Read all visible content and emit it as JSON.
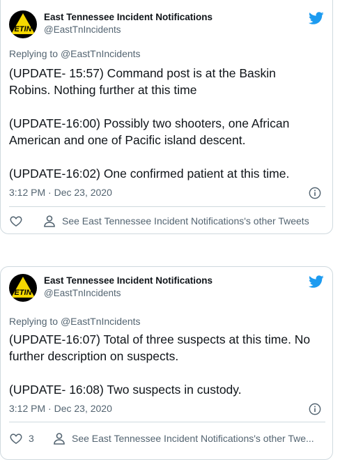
{
  "account": {
    "name": "East Tennessee Incident Notifications",
    "handle": "@EastTnIncidents",
    "avatar_text": "ETIN"
  },
  "colors": {
    "brand_yellow": "#f5d800",
    "twitter_blue": "#1d9bf0",
    "gray": "#536471"
  },
  "tweets": [
    {
      "replying_prefix": "Replying to",
      "replying_to": "@EastTnIncidents",
      "paragraphs": [
        "(UPDATE- 15:57) Command post is at the Baskin Robins. Nothing further at this time",
        "(UPDATE-16:00) Possibly two shooters, one African American and one of Pacific island descent.",
        "(UPDATE-16:02) One confirmed patient at this time."
      ],
      "timestamp": "3:12 PM · Dec 23, 2020",
      "like_count": "",
      "other_tweets_label": "See East Tennessee Incident Notifications's other Tweets"
    },
    {
      "replying_prefix": "Replying to",
      "replying_to": "@EastTnIncidents",
      "paragraphs": [
        "(UPDATE-16:07) Total of three suspects at this time. No further description on suspects.",
        "(UPDATE- 16:08) Two suspects in custody."
      ],
      "timestamp": "3:12 PM · Dec 23, 2020",
      "like_count": "3",
      "other_tweets_label": "See East Tennessee Incident Notifications's other Twe..."
    }
  ],
  "icons": [
    "twitter-bird-icon",
    "info-icon",
    "heart-icon",
    "person-icon"
  ]
}
